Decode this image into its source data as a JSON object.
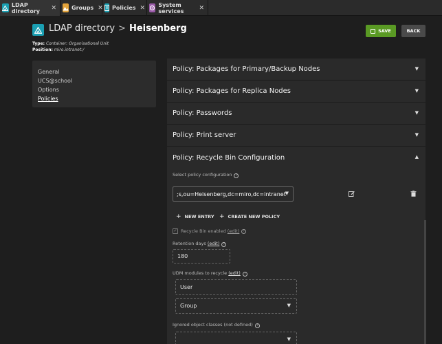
{
  "tabs": [
    {
      "label": "LDAP directory",
      "icon": "ldap-icon",
      "color": "#1b9fb2",
      "active": true
    },
    {
      "label": "Groups",
      "icon": "groups-icon",
      "color": "#e3a33b",
      "active": false
    },
    {
      "label": "Policies",
      "icon": "policies-icon",
      "color": "#1b9fb2",
      "active": false
    },
    {
      "label": "System services",
      "icon": "system-services-icon",
      "color": "#9a5aa8",
      "active": false
    }
  ],
  "breadcrumb": {
    "root": "LDAP directory",
    "separator": ">",
    "current": "Heisenberg"
  },
  "meta": {
    "type_label": "Type:",
    "type_value": "Container: Organisational Unit",
    "position_label": "Position:",
    "position_value": "miro.intranet:/"
  },
  "buttons": {
    "save": "SAVE",
    "back": "BACK"
  },
  "colors": {
    "accent": "#1b9fb2",
    "save": "#5a9a24",
    "background": "#1e1e1e",
    "panel": "#2a2a2a"
  },
  "sidenav": [
    "General",
    "UCS@school",
    "Options",
    "Policies"
  ],
  "policies": [
    {
      "title": "Policy: Packages for Primary/Backup Nodes",
      "expanded": false
    },
    {
      "title": "Policy: Packages for Replica Nodes",
      "expanded": false
    },
    {
      "title": "Policy: Passwords",
      "expanded": false
    },
    {
      "title": "Policy: Print server",
      "expanded": false
    },
    {
      "title": "Policy: Recycle Bin Configuration",
      "expanded": true
    }
  ],
  "recycle": {
    "select_label": "Select policy configuration",
    "select_value": ";s,ou=Heisenberg,dc=miro,dc=intranet",
    "new_entry": "NEW ENTRY",
    "create_policy": "CREATE NEW POLICY",
    "enabled_label": "Recycle Bin enabled",
    "edit_link": "(edit)",
    "retention_label": "Retention days",
    "retention_value": "180",
    "modules_label": "UDM modules to recycle",
    "modules": [
      "User",
      "Group"
    ],
    "ignored_label": "Ignored object classes (not defined)"
  }
}
